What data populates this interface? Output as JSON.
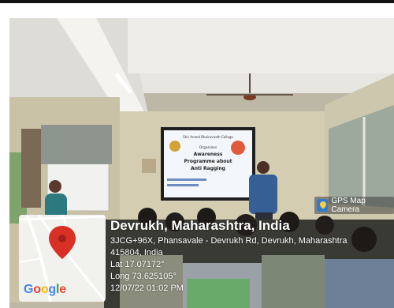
{
  "photo": {
    "slide_text": {
      "header": "Shri Anand Bhairavnath College",
      "line2": "Organizes",
      "line3": "Awareness",
      "line4": "Programme about",
      "line5": "Anti Ragging"
    }
  },
  "gps_badge": {
    "label": "GPS Map Camera",
    "icon": "map-pin-icon"
  },
  "map": {
    "brand": "Google",
    "pin_color": "#d93025"
  },
  "location": {
    "city": "Devrukh, Maharashtra, India",
    "address_line1": "3JCG+96X, Phansavale - Devrukh Rd, Devrukh, Maharashtra",
    "address_line2": "415804, India",
    "lat": "Lat 17.07172°",
    "long": "Long 73.625105°",
    "datetime": "12/07/22 01:02 PM"
  }
}
